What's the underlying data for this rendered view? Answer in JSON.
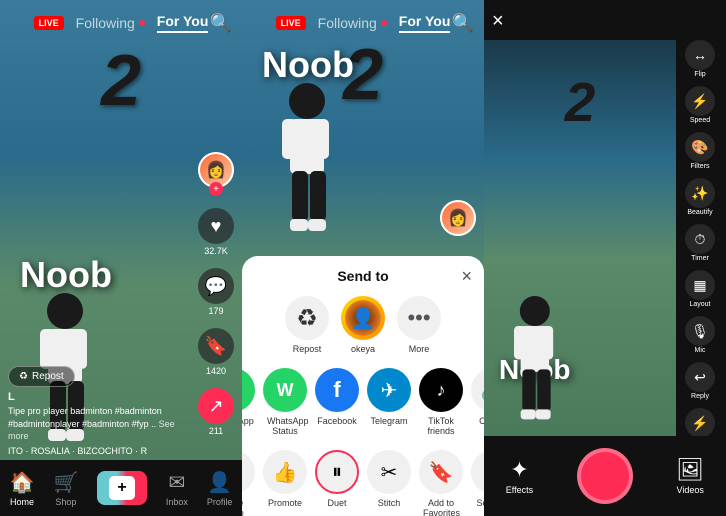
{
  "panel1": {
    "header": {
      "live_label": "LIVE",
      "following_label": "Following",
      "foryou_label": "For You"
    },
    "video": {
      "big_number": "2",
      "noob_text": "Noob",
      "likes": "32.7K",
      "comments": "179",
      "bookmarks": "1420",
      "shares": "211",
      "username": "L",
      "description": "Tipe pro player badminton #badminton #badmintonplayer #badminton #fyp ..",
      "see_more": "See more",
      "sound": "ITO · ROSALIA · BIZCOCHITO · R",
      "repost_label": "Repost"
    },
    "bottom_nav": {
      "home": "Home",
      "shop": "Shop",
      "inbox": "Inbox",
      "profile": "Profile"
    }
  },
  "panel2": {
    "header": {
      "live_label": "LIVE",
      "following_label": "Following",
      "foryou_label": "For You"
    },
    "video": {
      "big_number": "2",
      "noob_text": "Noob"
    },
    "send_to": {
      "title": "Send to",
      "close": "×",
      "row1": [
        {
          "label": "Repost",
          "icon": "♻"
        },
        {
          "label": "okeya",
          "icon": "👤"
        },
        {
          "label": "More",
          "icon": "⋯"
        }
      ],
      "row2": [
        {
          "label": "WhatsApp",
          "icon": "W",
          "color": "#25d366"
        },
        {
          "label": "WhatsApp Status",
          "icon": "W",
          "color": "#25d366"
        },
        {
          "label": "Facebook",
          "icon": "f",
          "color": "#1877f2"
        },
        {
          "label": "Telegram",
          "icon": "✈",
          "color": "#0088cc"
        },
        {
          "label": "TikTok friends",
          "icon": "♪",
          "color": "#010101"
        },
        {
          "label": "Copy...",
          "icon": "🔗",
          "color": "#f0f0f0"
        }
      ],
      "row3": [
        {
          "label": "Save video",
          "icon": "⬇"
        },
        {
          "label": "Promote",
          "icon": "👍"
        },
        {
          "label": "Duet",
          "icon": "⏸",
          "highlighted": true
        },
        {
          "label": "Stitch",
          "icon": "✂"
        },
        {
          "label": "Add to Favorites",
          "icon": "🔖"
        },
        {
          "label": "Set as...",
          "icon": "▶"
        }
      ]
    }
  },
  "panel3": {
    "close_icon": "×",
    "video": {
      "big_number": "2",
      "noob_text": "Noob"
    },
    "tools": [
      {
        "label": "Flip",
        "icon": "↔"
      },
      {
        "label": "Speed",
        "icon": "⚡"
      },
      {
        "label": "Filters",
        "icon": "🎨"
      },
      {
        "label": "Beautify",
        "icon": "✨"
      },
      {
        "label": "Timer",
        "icon": "⏱"
      },
      {
        "label": "Layout",
        "icon": "▦"
      },
      {
        "label": "Mic",
        "icon": "🎙"
      },
      {
        "label": "Reply",
        "icon": "↩"
      },
      {
        "label": "Flash",
        "icon": "⚡"
      }
    ],
    "bottom": {
      "effects_label": "Effects",
      "videos_label": "Videos"
    }
  }
}
